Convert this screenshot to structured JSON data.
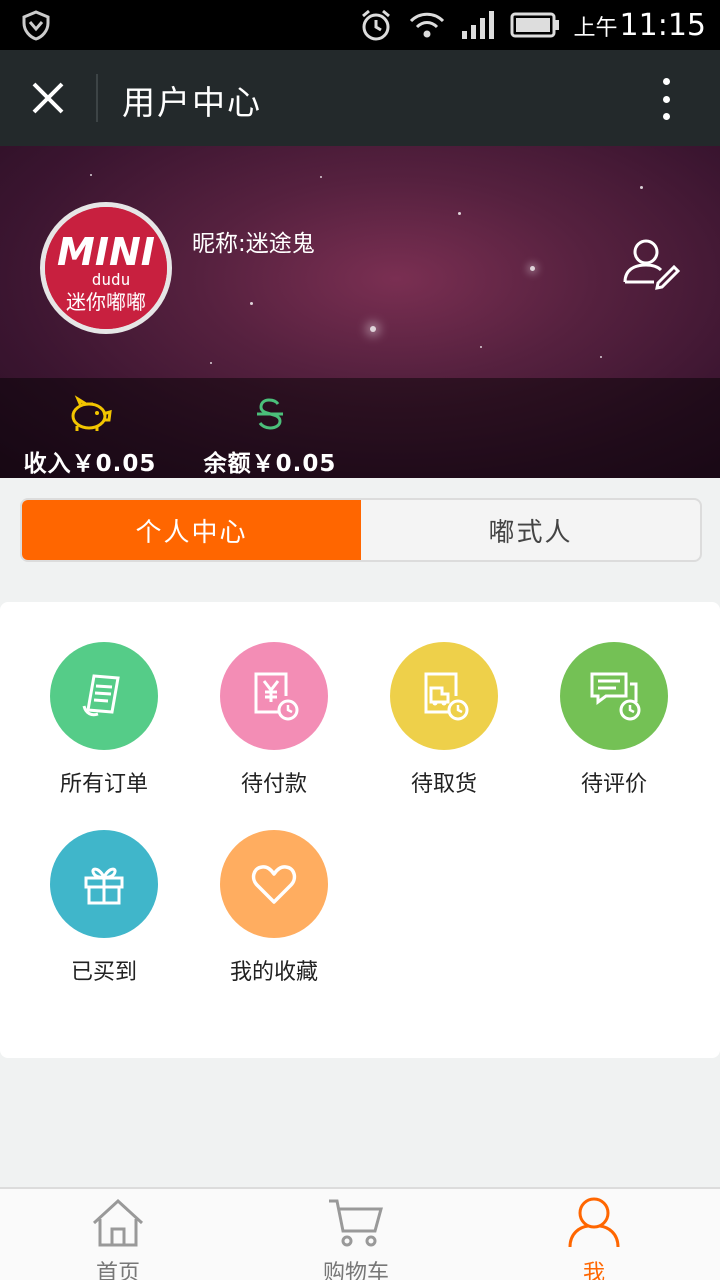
{
  "status_bar": {
    "ampm": "上午",
    "time": "11:15"
  },
  "app_bar": {
    "title": "用户中心"
  },
  "profile": {
    "nickname": "昵称:迷途鬼",
    "avatar_logo": "MINI dudu 迷你嘟嘟",
    "income": "收入￥0.05",
    "balance": "余额￥0.05"
  },
  "segments": [
    {
      "label": "个人中心",
      "active": true
    },
    {
      "label": "嘟式人",
      "active": false
    }
  ],
  "grid": [
    {
      "label": "所有订单",
      "icon": "receipt-icon",
      "color": "#55cc88"
    },
    {
      "label": "待付款",
      "icon": "pending-payment-icon",
      "color": "#f38db5"
    },
    {
      "label": "待取货",
      "icon": "pending-pickup-icon",
      "color": "#eed04a"
    },
    {
      "label": "待评价",
      "icon": "pending-review-icon",
      "color": "#74c155"
    },
    {
      "label": "已买到",
      "icon": "gift-icon",
      "color": "#40b6ca"
    },
    {
      "label": "我的收藏",
      "icon": "heart-icon",
      "color": "#ffad60"
    }
  ],
  "tabs": [
    {
      "label": "首页",
      "icon": "home-icon",
      "active": false
    },
    {
      "label": "购物车",
      "icon": "cart-icon",
      "active": false
    },
    {
      "label": "我",
      "icon": "user-icon",
      "active": true
    }
  ],
  "colors": {
    "accent": "#ff6600",
    "appbar": "#23292b"
  }
}
